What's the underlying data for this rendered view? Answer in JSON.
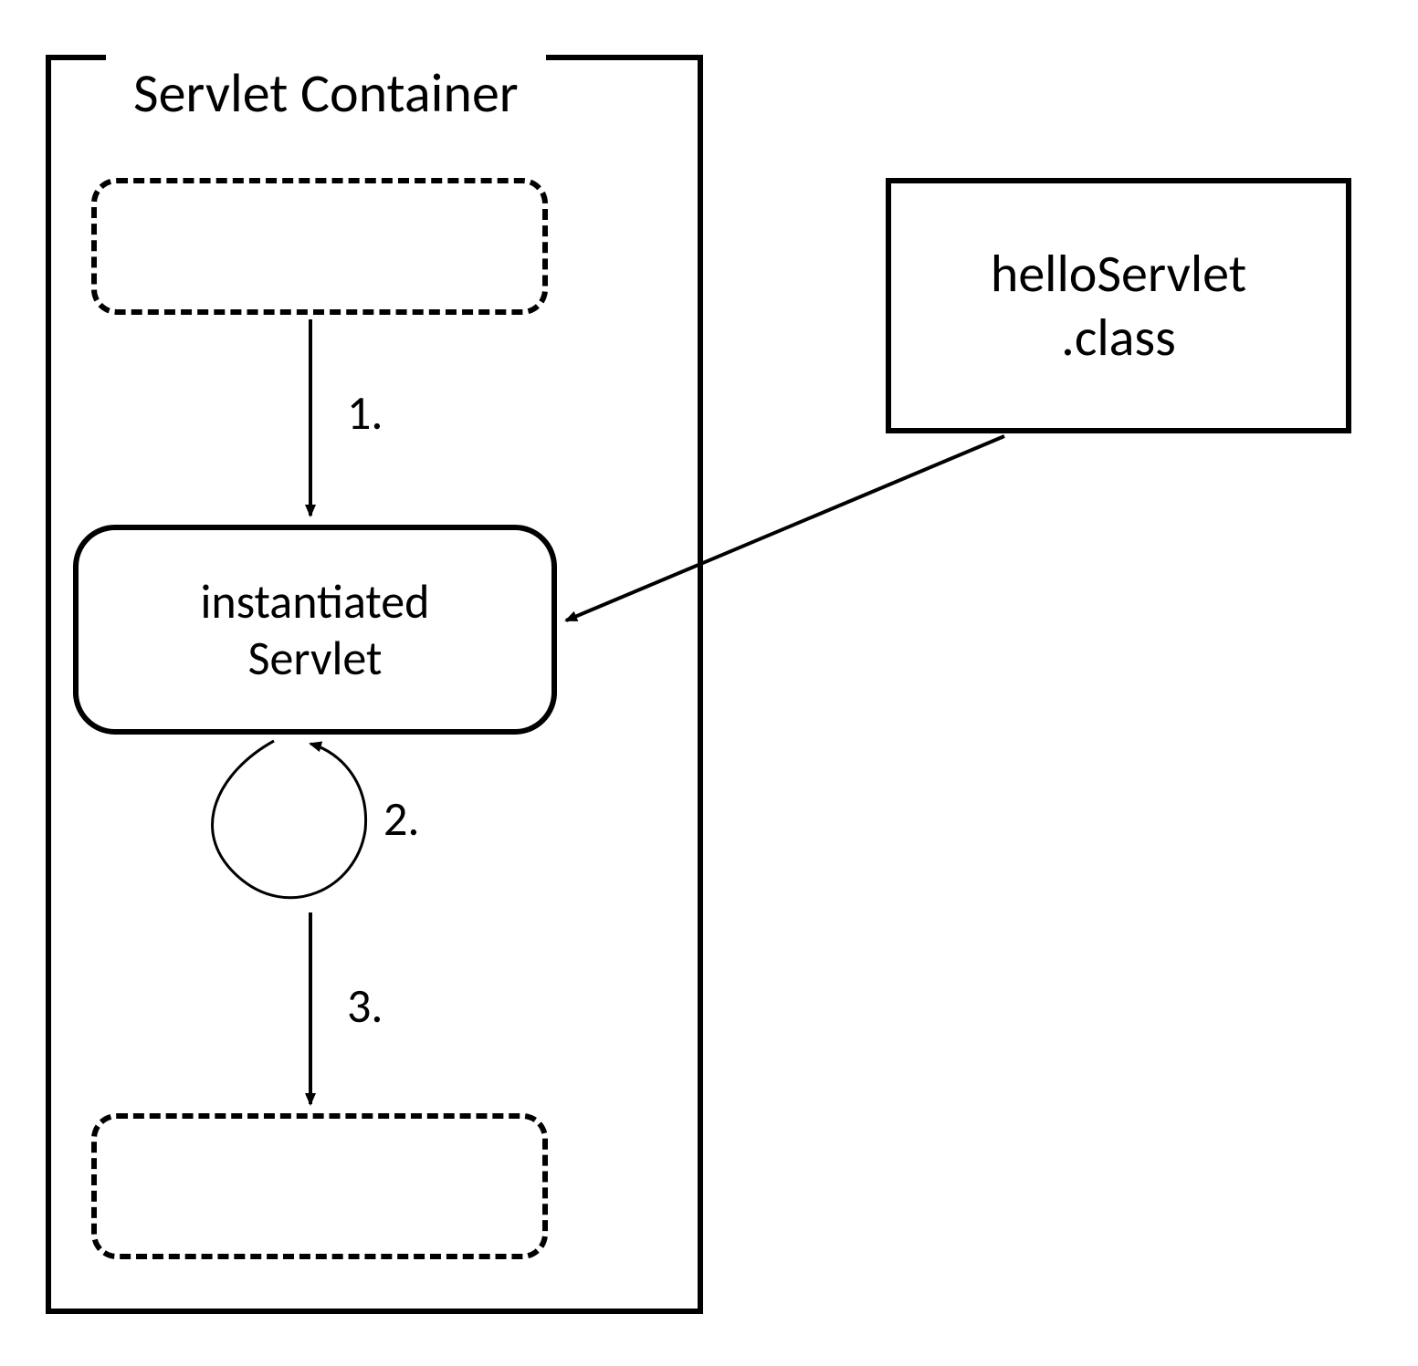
{
  "container": {
    "title": "Servlet Container"
  },
  "nodes": {
    "instantiated": "instantiated\nServlet",
    "class_file": "helloServlet\n.class"
  },
  "steps": {
    "one": "1.",
    "two": "2.",
    "three": "3."
  }
}
